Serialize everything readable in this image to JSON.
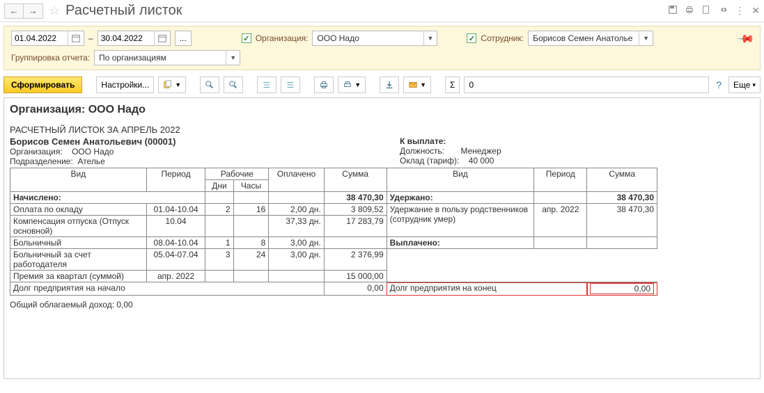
{
  "window": {
    "title": "Расчетный листок"
  },
  "filters": {
    "date_from": "01.04.2022",
    "date_to": "30.04.2022",
    "dash": "–",
    "org_label": "Организация:",
    "org_value": "ООО Надо",
    "emp_label": "Сотрудник:",
    "emp_value": "Борисов Семен Анатолье",
    "group_label": "Группировка отчета:",
    "group_value": "По организациям"
  },
  "toolbar": {
    "form_btn": "Сформировать",
    "settings_btn": "Настройки...",
    "sum_value": "0",
    "more_btn": "Еще"
  },
  "report": {
    "org_title": "Организация: ООО Надо",
    "period_title": "РАСЧЕТНЫЙ ЛИСТОК ЗА АПРЕЛЬ 2022",
    "employee": "Борисов Семен Анатольевич (00001)",
    "left_info": {
      "org_label": "Организация:",
      "org_value": "ООО Надо",
      "dept_label": "Подразделение:",
      "dept_value": "Ателье"
    },
    "right_info": {
      "pay_label": "К выплате:",
      "pos_label": "Должность:",
      "pos_value": "Менеджер",
      "salary_label": "Оклад (тариф):",
      "salary_value": "40 000"
    },
    "headers": {
      "vid": "Вид",
      "period": "Период",
      "rabochie": "Рабочие",
      "dni": "Дни",
      "chasy": "Часы",
      "oplacheno": "Оплачено",
      "summa": "Сумма"
    },
    "accrued_label": "Начислено:",
    "accrued_total": "38 470,30",
    "withheld_label": "Удержано:",
    "withheld_total": "38 470,30",
    "paid_label": "Выплачено:",
    "accruals": [
      {
        "name": "Оплата по окладу",
        "period": "01.04-10.04",
        "dni": "2",
        "chasy": "16",
        "opl": "2,00 дн.",
        "sum": "3 809,52"
      },
      {
        "name": "Компенсация отпуска (Отпуск основной)",
        "period": "10.04",
        "dni": "",
        "chasy": "",
        "opl": "37,33 дн.",
        "sum": "17 283,79"
      },
      {
        "name": "Больничный",
        "period": "08.04-10.04",
        "dni": "1",
        "chasy": "8",
        "opl": "3,00 дн.",
        "sum": ""
      },
      {
        "name": "Больничный за счет работодателя",
        "period": "05.04-07.04",
        "dni": "3",
        "chasy": "24",
        "opl": "3,00 дн.",
        "sum": "2 376,99"
      },
      {
        "name": "Премия за квартал (суммой)",
        "period": "апр. 2022",
        "dni": "",
        "chasy": "",
        "opl": "",
        "sum": "15 000,00"
      }
    ],
    "withholdings": [
      {
        "name": "Удержание в пользу родственников (сотрудник умер)",
        "period": "апр. 2022",
        "sum": "38 470,30"
      }
    ],
    "debt_start_label": "Долг предприятия на начало",
    "debt_start_value": "0,00",
    "debt_end_label": "Долг предприятия на конец",
    "debt_end_value": "0,00",
    "taxable_label": "Общий облагаемый доход:",
    "taxable_value": "0,00"
  }
}
